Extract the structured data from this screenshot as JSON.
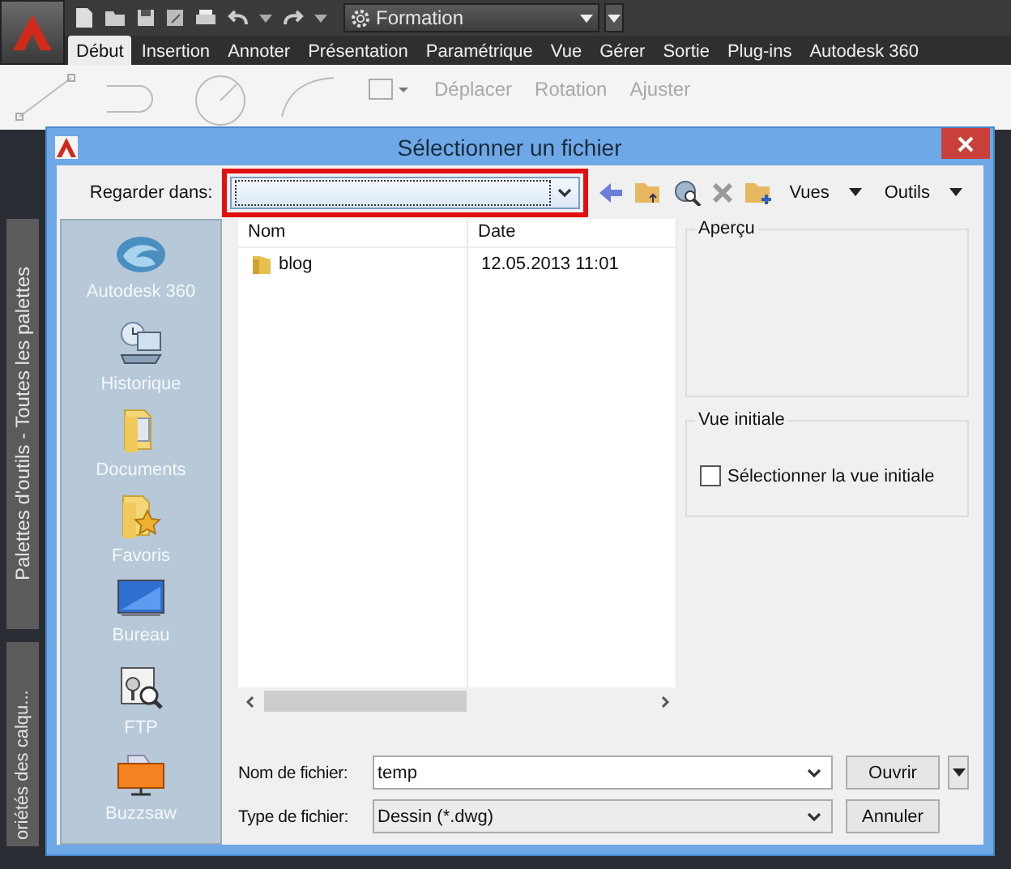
{
  "app": {
    "workspace": "Formation",
    "ribbon_tabs": [
      {
        "label": "Début",
        "selected": true
      },
      {
        "label": "Insertion",
        "selected": false
      },
      {
        "label": "Annoter",
        "selected": false
      },
      {
        "label": "Présentation",
        "selected": false
      },
      {
        "label": "Paramétrique",
        "selected": false
      },
      {
        "label": "Vue",
        "selected": false
      },
      {
        "label": "Gérer",
        "selected": false
      },
      {
        "label": "Sortie",
        "selected": false
      },
      {
        "label": "Plug-ins",
        "selected": false
      },
      {
        "label": "Autodesk 360",
        "selected": false
      }
    ],
    "ribbon_tools": [
      "Déplacer",
      "Rotation",
      "Ajuster"
    ],
    "side_palettes": [
      "Palettes d'outils - Toutes les palettes",
      "oriétés des calqu..."
    ]
  },
  "dialog": {
    "title": "Sélectionner un fichier",
    "look_in": {
      "label": "Regarder dans:"
    },
    "toolbar_menus": [
      "Vues",
      "Outils"
    ],
    "places": [
      {
        "label": "Autodesk 360",
        "kind": "cloud"
      },
      {
        "label": "Historique",
        "kind": "history"
      },
      {
        "label": "Documents",
        "kind": "documents"
      },
      {
        "label": "Favoris",
        "kind": "favorites"
      },
      {
        "label": "Bureau",
        "kind": "desktop"
      },
      {
        "label": "FTP",
        "kind": "ftp"
      },
      {
        "label": "Buzzsaw",
        "kind": "buzzsaw"
      }
    ],
    "file_list": {
      "columns": [
        "Nom",
        "Date"
      ],
      "rows": [
        {
          "name": "blog",
          "date": "12.05.2013 11:01"
        }
      ]
    },
    "preview": {
      "title": "Aperçu"
    },
    "initial_view": {
      "title": "Vue initiale",
      "checkbox": {
        "label": "Sélectionner la vue initiale",
        "checked": false
      }
    },
    "file_name": {
      "label": "Nom de fichier:",
      "value": "temp"
    },
    "file_type": {
      "label": "Type de fichier:",
      "value": "Dessin (*.dwg)"
    },
    "buttons": {
      "open": "Ouvrir",
      "cancel": "Annuler"
    }
  }
}
